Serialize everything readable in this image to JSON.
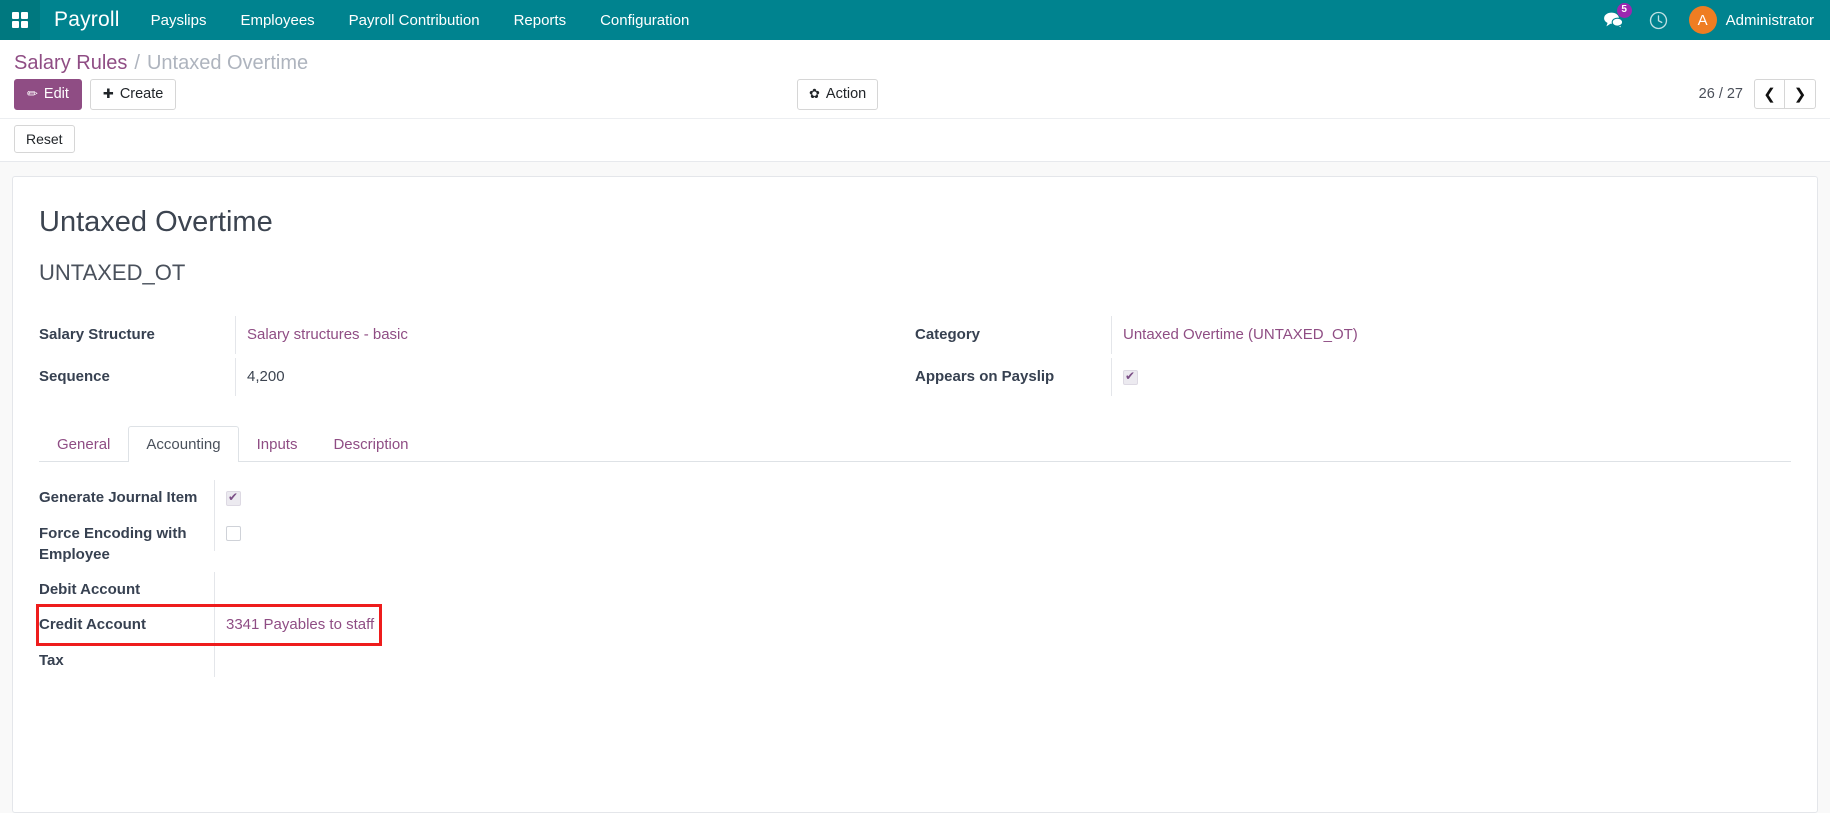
{
  "navbar": {
    "apps_icon": "grid-apps-icon",
    "brand": "Payroll",
    "menu_items": [
      {
        "label": "Payslips"
      },
      {
        "label": "Employees"
      },
      {
        "label": "Payroll Contribution"
      },
      {
        "label": "Reports"
      },
      {
        "label": "Configuration"
      }
    ],
    "messages_icon": "messages-icon",
    "messages_count": "5",
    "activity_icon": "clock-icon",
    "avatar_initial": "A",
    "user_name": "Administrator",
    "background_color": "#00838f",
    "avatar_color": "#ef7d22",
    "badge_color": "#9c27b0"
  },
  "control_panel": {
    "breadcrumb": {
      "parent": "Salary Rules",
      "separator": "/",
      "current": "Untaxed Overtime"
    },
    "edit_button": {
      "label": "Edit",
      "icon": "pencil-icon"
    },
    "create_button": {
      "label": "Create",
      "icon": "plus-icon"
    },
    "action_button": {
      "label": "Action",
      "icon": "gear-icon"
    },
    "pager": {
      "value": "26 / 27",
      "prev_icon": "chevron-left-icon",
      "next_icon": "chevron-right-icon"
    },
    "statusbar": {
      "reset_label": "Reset"
    },
    "accent_color": "#8f4d84"
  },
  "record": {
    "title": "Untaxed Overtime",
    "subtitle": "UNTAXED_OT",
    "fields_left": [
      {
        "label": "Salary Structure",
        "value": "Salary structures - basic"
      },
      {
        "label": "Sequence",
        "value": "4,200"
      }
    ],
    "fields_right": [
      {
        "label": "Category",
        "value": "Untaxed Overtime (UNTAXED_OT)"
      },
      {
        "label": "Appears on Payslip",
        "value": "",
        "checked": true
      }
    ]
  },
  "notebook": {
    "tabs": [
      {
        "label": "General",
        "active": false
      },
      {
        "label": "Accounting",
        "active": true
      },
      {
        "label": "Inputs",
        "active": false
      },
      {
        "label": "Description",
        "active": false
      }
    ],
    "accounting": {
      "rows": [
        {
          "label": "Generate Journal Item",
          "type": "checkbox",
          "checked": true,
          "value": ""
        },
        {
          "label": "Force Encoding with Employee",
          "type": "checkbox",
          "checked": false,
          "value": ""
        },
        {
          "label": "Debit Account",
          "type": "text",
          "value": ""
        },
        {
          "label": "Credit Account",
          "type": "link",
          "value": "3341 Payables to staff",
          "highlighted": true
        },
        {
          "label": "Tax",
          "type": "text",
          "value": ""
        }
      ]
    }
  },
  "highlight": {
    "color": "#ee1c1c"
  }
}
